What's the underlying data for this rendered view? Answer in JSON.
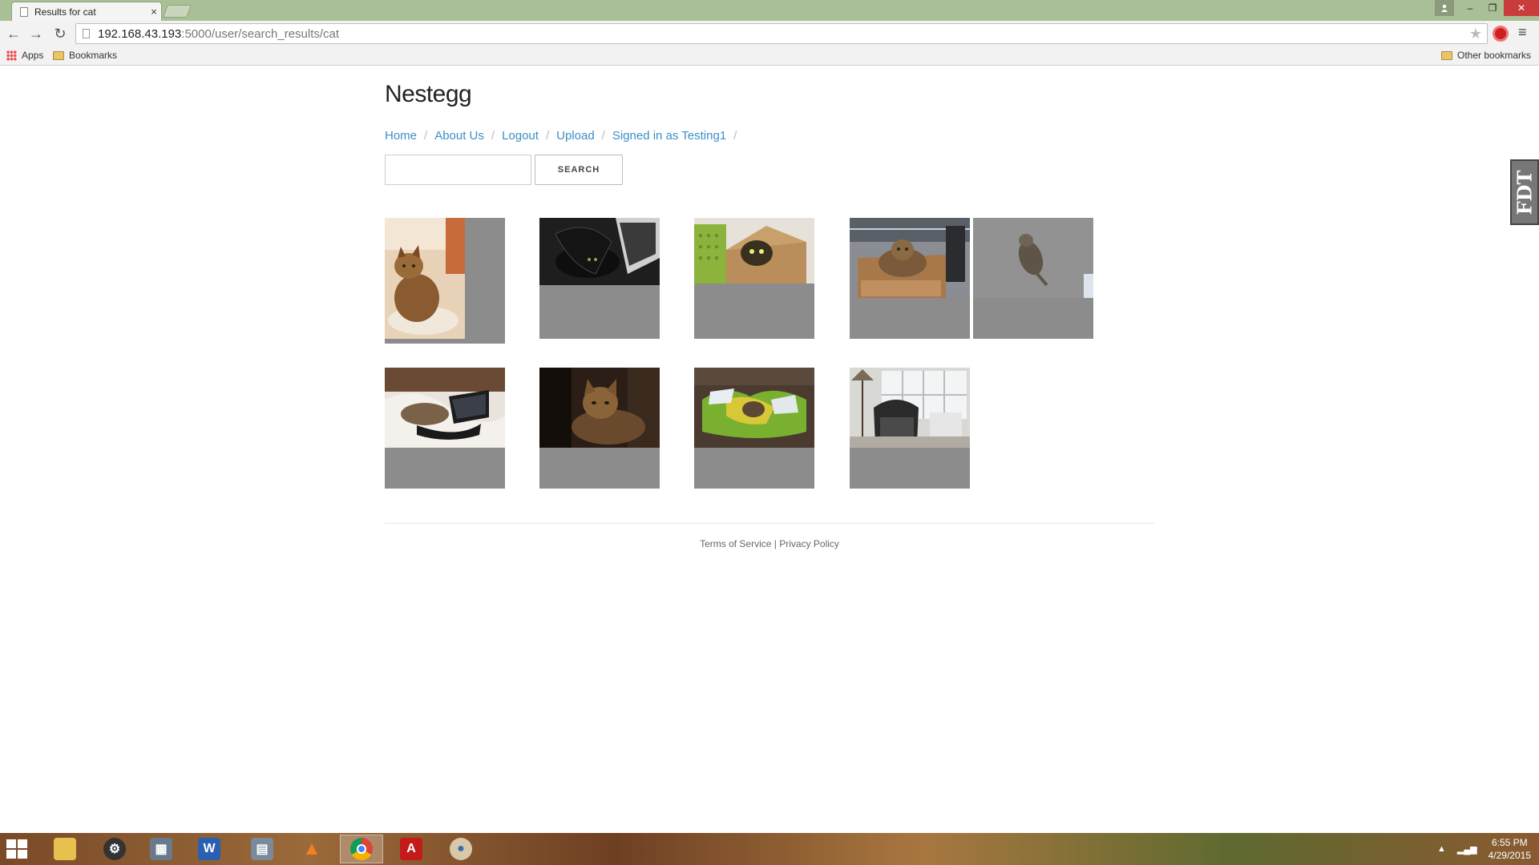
{
  "browser": {
    "tab_title": "Results for cat",
    "tab_close": "×",
    "url_host": "192.168.43.193",
    "url_path": ":5000/user/search_results/cat",
    "bookmarks": {
      "apps": "Apps",
      "bookmarks": "Bookmarks",
      "other": "Other bookmarks"
    },
    "window": {
      "minimize": "–",
      "restore": "❐",
      "close": "✕"
    }
  },
  "site": {
    "title": "Nestegg",
    "nav": {
      "home": "Home",
      "about": "About Us",
      "logout": "Logout",
      "upload": "Upload",
      "signed_in": "Signed in as Testing1"
    },
    "nav_separator": "/",
    "search_button": "SEARCH",
    "search_value": "",
    "footer": {
      "terms": "Terms of Service",
      "divider": " | ",
      "privacy": "Privacy Policy"
    },
    "side_badge": "FDT"
  },
  "results": {
    "query": "cat",
    "items": [
      {
        "subject": "cat sitting on chair"
      },
      {
        "subject": "black office chair and laptop"
      },
      {
        "subject": "cat in cardboard box by green basket"
      },
      {
        "subject": "cat in cardboard box"
      },
      {
        "subject": "cat lying on carpet"
      },
      {
        "subject": "cat on bed with laptop"
      },
      {
        "subject": "cat close-up in dark"
      },
      {
        "subject": "cat in pile of laundry"
      },
      {
        "subject": "sunroom with wicker chair"
      }
    ]
  },
  "taskbar": {
    "clock_time": "6:55 PM",
    "clock_date": "4/29/2015",
    "apps": [
      "file-explorer",
      "settings",
      "network",
      "word",
      "calculator",
      "vlc",
      "chrome",
      "acrobat",
      "paint"
    ],
    "active_app": "chrome"
  }
}
